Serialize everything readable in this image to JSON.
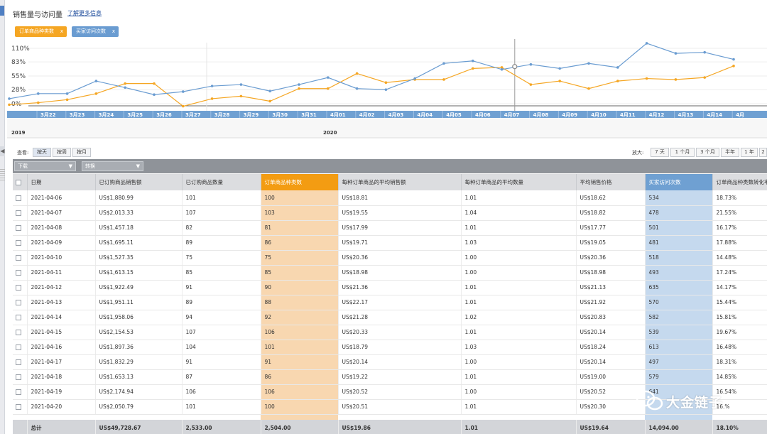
{
  "header": {
    "title": "销售量与访问量",
    "learn_more": "了解更多信息"
  },
  "tags": {
    "orange": {
      "label": "订单商品种类数",
      "close": "x"
    },
    "blue": {
      "label": "买家访问次数",
      "close": "x"
    }
  },
  "colors": {
    "orange": "#f5a623",
    "blue": "#6a9cd1",
    "bar_blue": "#6fa0d2"
  },
  "chart_data": {
    "type": "line",
    "y_ticks": [
      "110%",
      "83%",
      "55%",
      "28%",
      "0%"
    ],
    "ylim": [
      0,
      110
    ],
    "x": [
      "3月22",
      "3月23",
      "3月24",
      "3月25",
      "3月26",
      "3月27",
      "3月28",
      "3月29",
      "3月30",
      "3月31",
      "4月01",
      "4月02",
      "4月03",
      "4月04",
      "4月05",
      "4月06",
      "4月07",
      "4月08",
      "4月09",
      "4月10",
      "4月11",
      "4月12",
      "4月13",
      "4月14",
      "4月15"
    ],
    "x_labels": [
      "3月22",
      "3月23",
      "3月24",
      "3月25",
      "3月26",
      "3月27",
      "3月28",
      "3月29",
      "3月30",
      "3月31",
      "4月01",
      "4月02",
      "4月03",
      "4月04",
      "4月05",
      "4月06",
      "4月07",
      "4月08",
      "4月09",
      "4月10",
      "4月11",
      "4月12",
      "4月13",
      "4月14",
      "4月"
    ],
    "year_labels": [
      "2019",
      "2020"
    ],
    "series": [
      {
        "name": "订单商品种类数",
        "color": "#f5a623",
        "values": [
          -2,
          2,
          8,
          20,
          40,
          40,
          -5,
          10,
          15,
          5,
          30,
          30,
          60,
          42,
          48,
          48,
          70,
          72,
          38,
          45,
          30,
          45,
          50,
          48,
          52,
          75
        ]
      },
      {
        "name": "买家访问次数",
        "color": "#6a9cd1",
        "values": [
          10,
          20,
          20,
          45,
          32,
          18,
          24,
          35,
          38,
          25,
          38,
          52,
          30,
          28,
          50,
          80,
          85,
          68,
          78,
          70,
          80,
          72,
          120,
          100,
          102,
          88
        ]
      }
    ],
    "marker_date": "4月07"
  },
  "toolbar": {
    "view_label": "查看:",
    "view_buttons": [
      "按天",
      "按周",
      "按月"
    ],
    "zoom_label": "放大:",
    "zoom_buttons": [
      "7 天",
      "1 个月",
      "3 个月",
      "半年",
      "1 年",
      "2"
    ],
    "select_1": "下载",
    "select_2": "转换"
  },
  "table": {
    "columns": [
      "日期",
      "已订购商品销售额",
      "已订购商品数量",
      "订单商品种类数",
      "每种订单商品的平均销售额",
      "每种订单商品的平均数量",
      "平均销售价格",
      "买家访问次数",
      "订单商品种类数转化率"
    ],
    "rows": [
      [
        "2021-04-06",
        "US$1,880.99",
        "101",
        "100",
        "US$18.81",
        "1.01",
        "US$18.62",
        "534",
        "18.73%"
      ],
      [
        "2021-04-07",
        "US$2,013.33",
        "107",
        "103",
        "US$19.55",
        "1.04",
        "US$18.82",
        "478",
        "21.55%"
      ],
      [
        "2021-04-08",
        "US$1,457.18",
        "82",
        "81",
        "US$17.99",
        "1.01",
        "US$17.77",
        "501",
        "16.17%"
      ],
      [
        "2021-04-09",
        "US$1,695.11",
        "89",
        "86",
        "US$19.71",
        "1.03",
        "US$19.05",
        "481",
        "17.88%"
      ],
      [
        "2021-04-10",
        "US$1,527.35",
        "75",
        "75",
        "US$20.36",
        "1.00",
        "US$20.36",
        "518",
        "14.48%"
      ],
      [
        "2021-04-11",
        "US$1,613.15",
        "85",
        "85",
        "US$18.98",
        "1.00",
        "US$18.98",
        "493",
        "17.24%"
      ],
      [
        "2021-04-12",
        "US$1,922.49",
        "91",
        "90",
        "US$21.36",
        "1.01",
        "US$21.13",
        "635",
        "14.17%"
      ],
      [
        "2021-04-13",
        "US$1,951.11",
        "89",
        "88",
        "US$22.17",
        "1.01",
        "US$21.92",
        "570",
        "15.44%"
      ],
      [
        "2021-04-14",
        "US$1,958.06",
        "94",
        "92",
        "US$21.28",
        "1.02",
        "US$20.83",
        "582",
        "15.81%"
      ],
      [
        "2021-04-15",
        "US$2,154.53",
        "107",
        "106",
        "US$20.33",
        "1.01",
        "US$20.14",
        "539",
        "19.67%"
      ],
      [
        "2021-04-16",
        "US$1,897.36",
        "104",
        "101",
        "US$18.79",
        "1.03",
        "US$18.24",
        "613",
        "16.48%"
      ],
      [
        "2021-04-17",
        "US$1,832.29",
        "91",
        "91",
        "US$20.14",
        "1.00",
        "US$20.14",
        "497",
        "18.31%"
      ],
      [
        "2021-04-18",
        "US$1,653.13",
        "87",
        "86",
        "US$19.22",
        "1.01",
        "US$19.00",
        "579",
        "14.85%"
      ],
      [
        "2021-04-19",
        "US$2,174.94",
        "106",
        "106",
        "US$20.52",
        "1.00",
        "US$20.52",
        "641",
        "16.54%"
      ],
      [
        "2021-04-20",
        "US$2,050.79",
        "101",
        "100",
        "US$20.51",
        "1.01",
        "US$20.30",
        "",
        "16.%"
      ]
    ],
    "total": [
      "总计",
      "US$49,728.67",
      "2,533.00",
      "2,504.00",
      "US$19.86",
      "1.01",
      "US$19.64",
      "14,094.00",
      "18.10%"
    ]
  },
  "watermark": {
    "text": "大金链子"
  }
}
